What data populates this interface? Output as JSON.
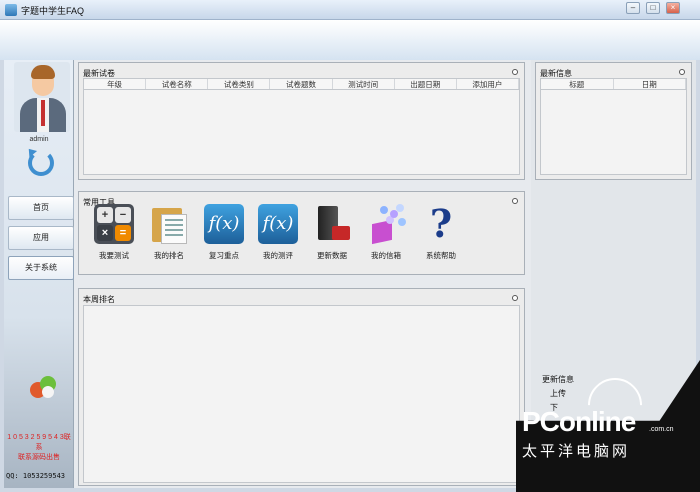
{
  "window": {
    "title": "字题中学生FAQ",
    "controls": [
      "minimize",
      "maximize",
      "close"
    ]
  },
  "sidebar": {
    "username": "admin",
    "nav": [
      {
        "label": "首页"
      },
      {
        "label": "应用"
      },
      {
        "label": "关于系统"
      }
    ],
    "notes": [
      "1 0 5 3 2 5 9 5 4 3联系",
      "联系源码出售"
    ],
    "qq": "QQ: 1053259543"
  },
  "latest_exams": {
    "title": "最新试卷",
    "columns": [
      "年级",
      "试卷名称",
      "试卷类别",
      "试卷题数",
      "测试时间",
      "出题日期",
      "添加用户"
    ],
    "rows": []
  },
  "tools": {
    "title": "常用工具",
    "items": [
      {
        "label": "我要测试",
        "icon": "calculator-icon"
      },
      {
        "label": "我的排名",
        "icon": "folder-documents-icon"
      },
      {
        "label": "复习重点",
        "icon": "function-fx-icon"
      },
      {
        "label": "我的测评",
        "icon": "function-fx-icon"
      },
      {
        "label": "更新数据",
        "icon": "server-update-icon"
      },
      {
        "label": "我的信箱",
        "icon": "mailbox-cube-icon"
      },
      {
        "label": "系统帮助",
        "icon": "question-mark-icon"
      }
    ]
  },
  "weekly_rank": {
    "title": "本周排名"
  },
  "latest_news": {
    "title": "最新信息",
    "columns": [
      "标题",
      "日期"
    ],
    "rows": []
  },
  "updates": {
    "title": "更新信息",
    "items": [
      "上传",
      "下"
    ]
  },
  "watermark": {
    "brand": "PConline",
    "domain": ".com.cn",
    "chinese": "太平洋电脑网"
  },
  "colors": {
    "accent": "#3f8fd0",
    "note_red": "#d22222",
    "panel_bg": "#ececec"
  }
}
